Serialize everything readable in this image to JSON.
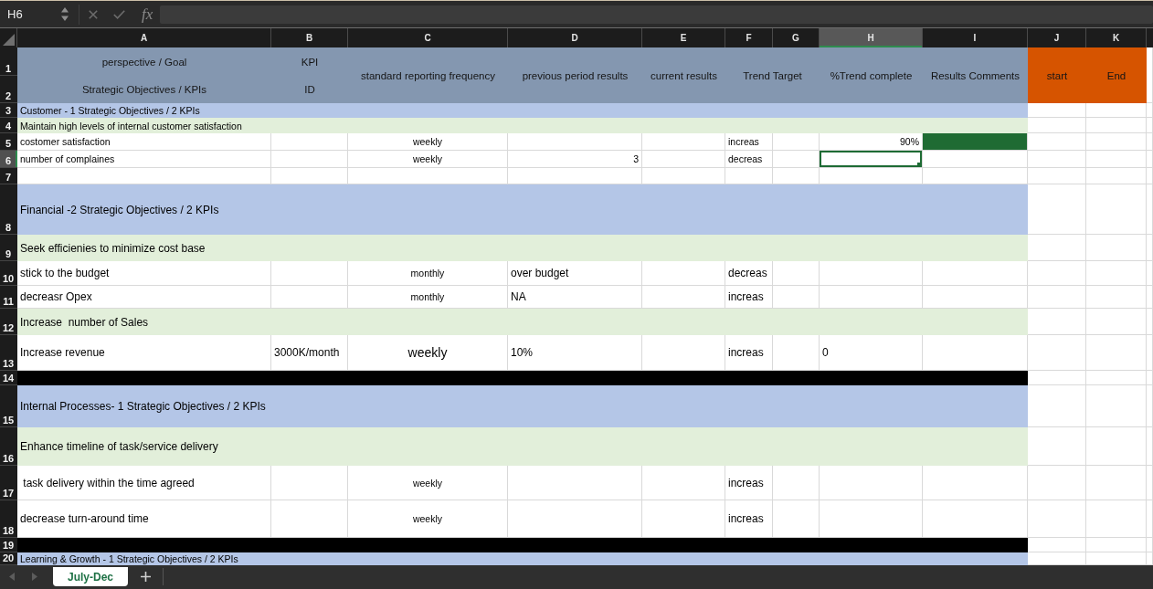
{
  "formula_bar": {
    "name_box": "H6",
    "function_button": "fx"
  },
  "column_headers": [
    {
      "label": "A",
      "selected": false
    },
    {
      "label": "B",
      "selected": false
    },
    {
      "label": "C",
      "selected": false
    },
    {
      "label": "D",
      "selected": false
    },
    {
      "label": "E",
      "selected": false
    },
    {
      "label": "F",
      "selected": false
    },
    {
      "label": "G",
      "selected": false
    },
    {
      "label": "H",
      "selected": true
    },
    {
      "label": "I",
      "selected": false
    },
    {
      "label": "J",
      "selected": false
    },
    {
      "label": "K",
      "selected": false
    }
  ],
  "header_rows": [
    {
      "number": "1",
      "selected": false
    },
    {
      "number": "2",
      "selected": false
    }
  ],
  "header_cells": [
    {
      "kind": "stacked",
      "line_1": "perspective / Goal",
      "line_2": "Strategic Objectives / KPIs",
      "color": "#8497b0"
    },
    {
      "kind": "stacked",
      "line_1": "KPI",
      "line_2": "ID",
      "color": "#8497b0"
    },
    {
      "kind": "merged",
      "text": "standard reporting frequency",
      "color": "#8497b0"
    },
    {
      "kind": "merged",
      "text": "previous period results",
      "color": "#8497b0"
    },
    {
      "kind": "merged",
      "text": "current results",
      "color": "#8497b0"
    },
    {
      "kind": "wide",
      "text": "Trend Target",
      "color": "#8497b0"
    },
    {
      "kind": "merged",
      "text": "%Trend complete",
      "color": "#8497b0"
    },
    {
      "kind": "merged",
      "text": "Results Comments",
      "color": "#8497b0"
    },
    {
      "kind": "merged",
      "text": "start",
      "color": "#d65400"
    },
    {
      "kind": "merged",
      "text": "End",
      "color": "#d65400"
    }
  ],
  "rows": [
    {
      "number": "3",
      "selected": false,
      "kind": "section",
      "text": "Customer - 1 Strategic Objectives / 2 KPIs"
    },
    {
      "number": "4",
      "selected": false,
      "kind": "objective",
      "text": "Maintain high levels of internal customer satisfaction"
    },
    {
      "number": "5",
      "selected": false,
      "kind": "kpi",
      "cells": [
        {
          "kind": "text",
          "text": "costomer satisfaction"
        },
        {
          "kind": "empty"
        },
        {
          "kind": "text",
          "text": "weekly"
        },
        {
          "kind": "empty"
        },
        {
          "kind": "empty"
        },
        {
          "kind": "text",
          "text": "increas"
        },
        {
          "kind": "empty"
        },
        {
          "kind": "number",
          "text": "90%"
        },
        {
          "kind": "fill",
          "color": "#1f6b33"
        }
      ]
    },
    {
      "number": "6",
      "selected": true,
      "kind": "kpi",
      "cells": [
        {
          "kind": "text",
          "text": "number of complaines"
        },
        {
          "kind": "empty"
        },
        {
          "kind": "text",
          "text": "weekly"
        },
        {
          "kind": "number",
          "text": "3"
        },
        {
          "kind": "empty"
        },
        {
          "kind": "text",
          "text": "decreas"
        }
      ]
    },
    {
      "number": "7",
      "selected": false,
      "kind": "blank"
    },
    {
      "number": "8",
      "selected": false,
      "kind": "section",
      "text": "Financial -2 Strategic Objectives / 2 KPIs"
    },
    {
      "number": "9",
      "selected": false,
      "kind": "objective",
      "text": "Seek efficienies to minimize cost base"
    },
    {
      "number": "10",
      "selected": false,
      "kind": "kpi",
      "cells": [
        {
          "kind": "text",
          "text": "stick to the budget"
        },
        {
          "kind": "empty"
        },
        {
          "kind": "text",
          "text": "monthly"
        },
        {
          "kind": "text",
          "text": "over budget"
        },
        {
          "kind": "empty"
        },
        {
          "kind": "text",
          "text": "decreas"
        }
      ]
    },
    {
      "number": "11",
      "selected": false,
      "kind": "kpi",
      "cells": [
        {
          "kind": "text",
          "text": "decreasr Opex"
        },
        {
          "kind": "empty"
        },
        {
          "kind": "text",
          "text": "monthly"
        },
        {
          "kind": "text",
          "text": "NA"
        },
        {
          "kind": "empty"
        },
        {
          "kind": "text",
          "text": "increas"
        }
      ]
    },
    {
      "number": "12",
      "selected": false,
      "kind": "objective",
      "text": "Increase  number of Sales"
    },
    {
      "number": "13",
      "selected": false,
      "kind": "kpi",
      "cells": [
        {
          "kind": "text",
          "text": "Increase revenue"
        },
        {
          "kind": "text",
          "text": "3000K/month"
        },
        {
          "kind": "text",
          "text": "weekly"
        },
        {
          "kind": "text",
          "text": "10%"
        },
        {
          "kind": "empty"
        },
        {
          "kind": "text",
          "text": "increas"
        },
        {
          "kind": "empty"
        },
        {
          "kind": "text",
          "text": "0"
        }
      ]
    },
    {
      "number": "14",
      "selected": false,
      "kind": "separator"
    },
    {
      "number": "15",
      "selected": false,
      "kind": "section",
      "text": "Internal Processes- 1 Strategic Objectives / 2 KPIs"
    },
    {
      "number": "16",
      "selected": false,
      "kind": "objective",
      "text": "Enhance timeline of task/service delivery"
    },
    {
      "number": "17",
      "selected": false,
      "kind": "kpi",
      "cells": [
        {
          "kind": "text",
          "text": " task delivery within the time agreed"
        },
        {
          "kind": "empty"
        },
        {
          "kind": "text",
          "text": "weekly"
        },
        {
          "kind": "empty"
        },
        {
          "kind": "empty"
        },
        {
          "kind": "text",
          "text": "increas"
        }
      ]
    },
    {
      "number": "18",
      "selected": false,
      "kind": "kpi",
      "cells": [
        {
          "kind": "text",
          "text": "decrease turn-around time"
        },
        {
          "kind": "empty"
        },
        {
          "kind": "text",
          "text": "weekly"
        },
        {
          "kind": "empty"
        },
        {
          "kind": "empty"
        },
        {
          "kind": "text",
          "text": "increas"
        }
      ]
    },
    {
      "number": "19",
      "selected": false,
      "kind": "separator"
    },
    {
      "number": "20",
      "selected": false,
      "kind": "section",
      "text": "Learning & Growth - 1 Strategic Objectives / 2 KPIs"
    }
  ],
  "sheet_tabs": [
    {
      "label": "July-Dec",
      "selected": true
    }
  ]
}
